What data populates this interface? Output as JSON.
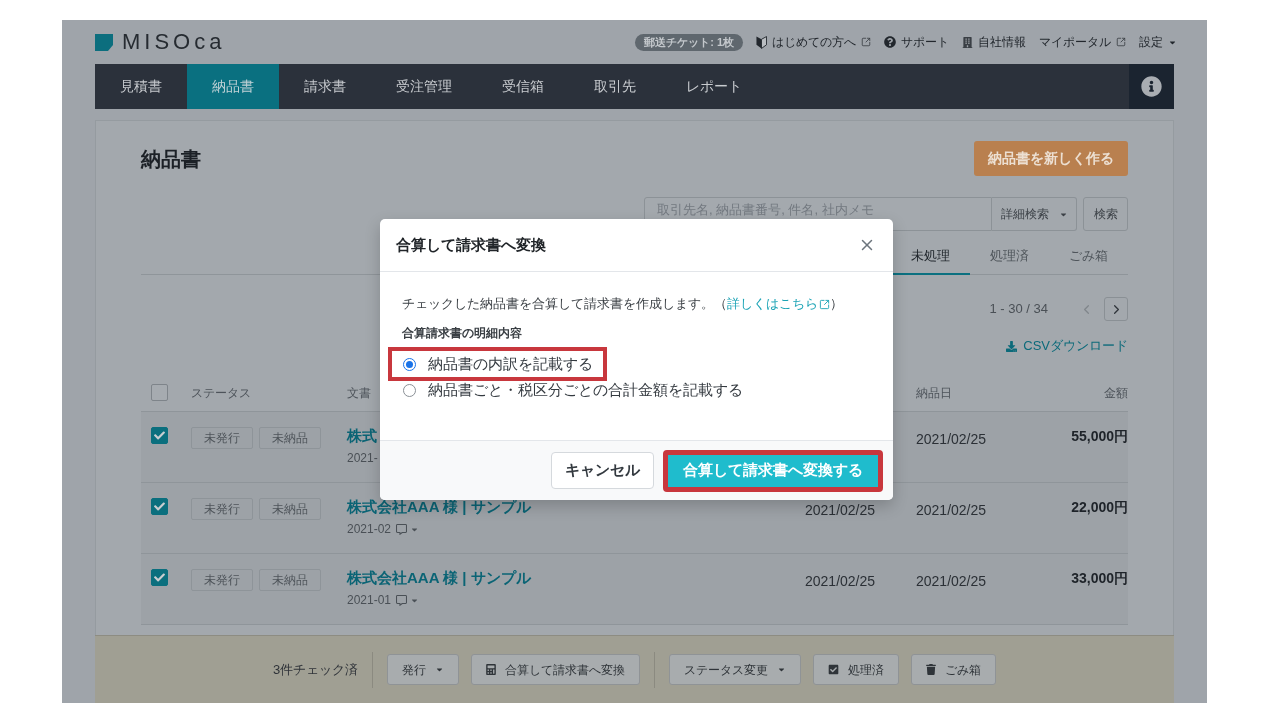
{
  "header": {
    "logo": "MISOca",
    "ticket_badge": "郵送チケット: 1枚",
    "links": [
      {
        "label": "はじめての方へ",
        "kind": "guide",
        "external": true
      },
      {
        "label": "サポート",
        "kind": "support",
        "external": false
      },
      {
        "label": "自社情報",
        "kind": "company",
        "external": false
      },
      {
        "label": "マイポータル",
        "kind": "portal",
        "external": true
      },
      {
        "label": "設定",
        "kind": "menu",
        "external": false
      }
    ]
  },
  "nav": {
    "tabs": [
      {
        "label": "見積書",
        "selected": false
      },
      {
        "label": "納品書",
        "selected": true
      },
      {
        "label": "請求書",
        "selected": false
      },
      {
        "label": "受注管理",
        "selected": false
      },
      {
        "label": "受信箱",
        "selected": false
      },
      {
        "label": "取引先",
        "selected": false
      },
      {
        "label": "レポート",
        "selected": false
      }
    ]
  },
  "page": {
    "title": "納品書",
    "new_button": "納品書を新しく作る",
    "search": {
      "placeholder": "取引先名, 納品書番号, 件名, 社内メモ",
      "advanced": "詳細検索",
      "submit": "検索"
    },
    "filter_tabs": [
      {
        "label": "未処理",
        "selected": true
      },
      {
        "label": "処理済",
        "selected": false
      },
      {
        "label": "ごみ箱",
        "selected": false
      }
    ],
    "pagination": {
      "range": "1 - 30 / 34",
      "prev_disabled": true,
      "next_disabled": false
    },
    "csv_link": "CSVダウンロード"
  },
  "table": {
    "select_all_checked": false,
    "columns": [
      {
        "label": "ステータス"
      },
      {
        "label": "文書"
      },
      {
        "label": "納品日"
      },
      {
        "label": "金額"
      }
    ],
    "rows": [
      {
        "checked": true,
        "statuses": [
          "未発行",
          "未納品"
        ],
        "title": "株式",
        "number": "2021-",
        "comment_menu": false,
        "delivery_date": "2021/02/25",
        "amount": "55,000円"
      },
      {
        "checked": true,
        "statuses": [
          "未発行",
          "未納品"
        ],
        "title": "株式会社AAA 様 | サンプル",
        "number": "2021-02",
        "comment_menu": true,
        "column_3": "2021/02/25",
        "delivery_date": "2021/02/25",
        "amount": "22,000円"
      },
      {
        "checked": true,
        "statuses": [
          "未発行",
          "未納品"
        ],
        "title": "株式会社AAA 様 | サンプル",
        "number": "2021-01",
        "comment_menu": true,
        "column_3": "2021/02/25",
        "delivery_date": "2021/02/25",
        "amount": "33,000円"
      }
    ]
  },
  "bulk_bar": {
    "count": "3件チェック済",
    "groups": [
      {
        "actions": [
          {
            "label": "発行",
            "kind": "dropdown"
          },
          {
            "label": "合算して請求書へ変換",
            "kind": "merge"
          }
        ]
      },
      {
        "actions": [
          {
            "label": "ステータス変更",
            "kind": "dropdown"
          },
          {
            "label": "処理済",
            "kind": "done"
          },
          {
            "label": "ごみ箱",
            "kind": "trash"
          }
        ]
      }
    ]
  },
  "dialog": {
    "title": "合算して請求書へ変換",
    "description": {
      "text": "チェックした納品書を合算して請求書を作成します。（",
      "link": "詳しくはこちら",
      "text_after": "）"
    },
    "section_label": "合算請求書の明細内容",
    "options": [
      {
        "label": "納品書の内訳を記載する",
        "selected": true,
        "highlighted": true
      },
      {
        "label": "納品書ごと・税区分ごとの合計金額を記載する",
        "selected": false,
        "highlighted": false
      }
    ],
    "buttons": [
      {
        "label": "キャンセル",
        "kind": "secondary",
        "highlighted": false
      },
      {
        "label": "合算して請求書へ変換する",
        "kind": "primary",
        "highlighted": true
      }
    ]
  }
}
